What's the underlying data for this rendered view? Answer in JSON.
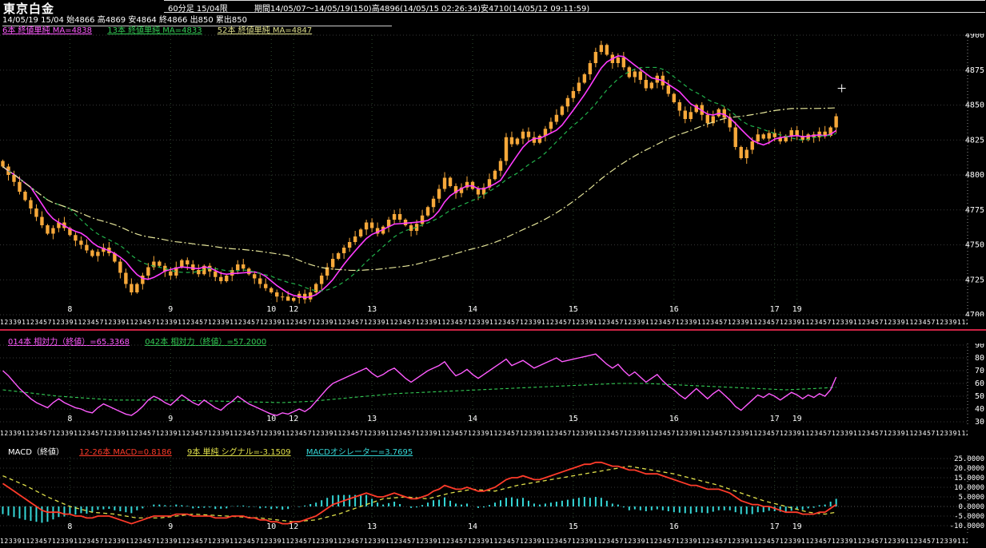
{
  "header": {
    "title": "東京白金",
    "timeframe": "60分足 15/04限",
    "period_info": "期間14/05/07～14/05/19(150)高4896(14/05/15 02:26:34)安4710(14/05/12 09:11:59)",
    "quote_line": "14/05/19 15/04 始4866 高4869 安4864 終4866 出850 累出850",
    "ma_legend": [
      {
        "label": "6本 終値単純 MA=4838",
        "color": "#ff5bff"
      },
      {
        "label": "13本 終値単純 MA=4833",
        "color": "#33cc55"
      },
      {
        "label": "52本 終値単純 MA=4847",
        "color": "#dede8a"
      }
    ]
  },
  "colors": {
    "background": "#000000",
    "candle": "#f6a83a",
    "grid": "#383838",
    "day_grid": "#2d4a2d",
    "axis_text": "#ffffff",
    "separator": "#cc2244",
    "cursor": "#ffffff",
    "right_border": "#999999"
  },
  "time_axis": {
    "pattern": "123391123457",
    "repeat": 20
  },
  "chart_data": [
    {
      "type": "candlestick",
      "title": "東京白金 60分足 15/04限",
      "ylim": [
        4700,
        4900
      ],
      "yticks": [
        4900,
        4875,
        4850,
        4825,
        4800,
        4775,
        4750,
        4725,
        4700
      ],
      "total_slots": 173,
      "first_open": 4810,
      "high": {
        "value": 4896,
        "bar": 107,
        "time": "14/05/15 02:26:34"
      },
      "low": {
        "value": 4710,
        "bar": 51,
        "time": "14/05/12 09:11:59"
      },
      "cursor": {
        "bar": 150,
        "price": 4862
      },
      "closes": [
        4806,
        4800,
        4795,
        4788,
        4782,
        4776,
        4770,
        4764,
        4758,
        4762,
        4766,
        4762,
        4757,
        4753,
        4750,
        4746,
        4742,
        4745,
        4748,
        4744,
        4738,
        4730,
        4722,
        4716,
        4722,
        4728,
        4734,
        4738,
        4735,
        4731,
        4728,
        4734,
        4739,
        4736,
        4732,
        4729,
        4735,
        4731,
        4727,
        4724,
        4728,
        4732,
        4736,
        4733,
        4729,
        4726,
        4722,
        4719,
        4716,
        4713,
        4713,
        4710,
        4712,
        4715,
        4711,
        4716,
        4722,
        4728,
        4734,
        4740,
        4744,
        4748,
        4752,
        4756,
        4761,
        4766,
        4762,
        4758,
        4763,
        4768,
        4772,
        4768,
        4764,
        4760,
        4765,
        4771,
        4777,
        4783,
        4790,
        4798,
        4792,
        4787,
        4791,
        4795,
        4790,
        4786,
        4791,
        4797,
        4803,
        4810,
        4827,
        4822,
        4826,
        4831,
        4827,
        4823,
        4828,
        4833,
        4838,
        4843,
        4849,
        4855,
        4860,
        4866,
        4872,
        4880,
        4888,
        4893,
        4886,
        4880,
        4884,
        4877,
        4870,
        4874,
        4868,
        4862,
        4866,
        4871,
        4864,
        4858,
        4852,
        4846,
        4840,
        4845,
        4850,
        4843,
        4837,
        4842,
        4847,
        4841,
        4834,
        4820,
        4812,
        4818,
        4824,
        4829,
        4826,
        4830,
        4827,
        4824,
        4828,
        4832,
        4828,
        4825,
        4829,
        4827,
        4831,
        4828,
        4834,
        4842
      ],
      "day_labels": [
        {
          "label": "8",
          "bar": 12
        },
        {
          "label": "9",
          "bar": 30
        },
        {
          "label": "10",
          "bar": 48
        },
        {
          "label": "12",
          "bar": 52
        },
        {
          "label": "13",
          "bar": 66
        },
        {
          "label": "14",
          "bar": 84
        },
        {
          "label": "15",
          "bar": 102
        },
        {
          "label": "16",
          "bar": 120
        },
        {
          "label": "17",
          "bar": 138
        },
        {
          "label": "19",
          "bar": 142
        }
      ],
      "moving_averages": [
        {
          "name": "MA6",
          "period": 6,
          "color": "#ff3bff",
          "style": "solid"
        },
        {
          "name": "MA13",
          "period": 13,
          "color": "#21b14b",
          "style": "dashed"
        },
        {
          "name": "MA52",
          "period": 52,
          "color": "#e6e69a",
          "style": "dashdot"
        }
      ]
    },
    {
      "type": "line",
      "name": "RSI",
      "legend": [
        {
          "label": "014本 相対力（終値）=65.3368",
          "color": "#ff5bff"
        },
        {
          "label": "042本 相対力（終値）=57.2000",
          "color": "#33cc55"
        }
      ],
      "ylim": [
        30,
        90
      ],
      "yticks": [
        90,
        80,
        70,
        60,
        50,
        40,
        30
      ],
      "rsi14": [
        70,
        66,
        61,
        56,
        52,
        48,
        45,
        43,
        41,
        45,
        48,
        45,
        43,
        41,
        40,
        38,
        37,
        41,
        44,
        42,
        40,
        38,
        36,
        35,
        38,
        42,
        47,
        50,
        48,
        45,
        43,
        47,
        51,
        48,
        45,
        43,
        47,
        44,
        41,
        39,
        43,
        46,
        50,
        47,
        44,
        42,
        40,
        38,
        36,
        35,
        37,
        36,
        38,
        40,
        38,
        41,
        46,
        51,
        56,
        60,
        62,
        64,
        66,
        68,
        70,
        72,
        68,
        65,
        67,
        70,
        72,
        68,
        64,
        61,
        64,
        67,
        70,
        72,
        74,
        77,
        71,
        66,
        68,
        71,
        67,
        64,
        67,
        70,
        73,
        76,
        79,
        74,
        76,
        78,
        75,
        72,
        74,
        76,
        78,
        80,
        77,
        78,
        79,
        80,
        81,
        82,
        83,
        79,
        75,
        72,
        75,
        70,
        66,
        69,
        65,
        61,
        64,
        67,
        62,
        58,
        55,
        51,
        48,
        52,
        56,
        52,
        48,
        52,
        55,
        51,
        47,
        42,
        39,
        43,
        47,
        51,
        49,
        52,
        50,
        47,
        50,
        53,
        51,
        48,
        51,
        49,
        52,
        50,
        55,
        65
      ],
      "rsi42_points": [
        [
          0,
          55
        ],
        [
          10,
          50
        ],
        [
          20,
          47
        ],
        [
          30,
          47
        ],
        [
          40,
          46
        ],
        [
          50,
          45
        ],
        [
          55,
          46
        ],
        [
          60,
          48
        ],
        [
          65,
          50
        ],
        [
          70,
          52
        ],
        [
          75,
          53
        ],
        [
          80,
          54
        ],
        [
          85,
          55
        ],
        [
          90,
          56
        ],
        [
          95,
          57
        ],
        [
          100,
          58
        ],
        [
          105,
          59
        ],
        [
          110,
          60
        ],
        [
          115,
          60
        ],
        [
          120,
          59
        ],
        [
          125,
          58
        ],
        [
          130,
          57
        ],
        [
          135,
          56
        ],
        [
          140,
          55
        ],
        [
          145,
          56
        ],
        [
          149,
          57
        ]
      ]
    },
    {
      "type": "macd",
      "legend": [
        {
          "label": "MACD（終値）",
          "color": "#ffffff"
        },
        {
          "label": "12-26本 MACD=0.8186",
          "color": "#ff3b2a"
        },
        {
          "label": "9本 単純 シグナル=-3.1509",
          "color": "#e0e04a"
        },
        {
          "label": "MACDオシレーター=3.7695",
          "color": "#35d8d8"
        }
      ],
      "ylim": [
        -10,
        25
      ],
      "yticks": [
        25,
        20,
        15,
        10,
        5,
        0,
        -5,
        -10
      ],
      "ytick_labels": [
        "25.0000",
        "20.0000",
        "15.0000",
        "10.0000",
        "5.0000",
        "0.0000",
        "-5.0000",
        "-10.0000"
      ],
      "macd": [
        12,
        10,
        8,
        6,
        4,
        2,
        0,
        -2,
        -3,
        -3,
        -3,
        -4,
        -4,
        -5,
        -5,
        -6,
        -6,
        -5,
        -5,
        -5,
        -6,
        -7,
        -8,
        -9,
        -8,
        -7,
        -6,
        -5,
        -5,
        -5,
        -5,
        -4,
        -4,
        -4,
        -5,
        -5,
        -5,
        -5,
        -6,
        -6,
        -6,
        -5,
        -5,
        -5,
        -6,
        -6,
        -7,
        -7,
        -8,
        -8,
        -9,
        -9,
        -8,
        -8,
        -7,
        -6,
        -5,
        -3,
        -1,
        1,
        2,
        3,
        4,
        5,
        6,
        7,
        6,
        5,
        5,
        6,
        7,
        6,
        5,
        4,
        4,
        5,
        6,
        8,
        9,
        11,
        10,
        9,
        9,
        10,
        9,
        8,
        8,
        9,
        10,
        12,
        14,
        15,
        15,
        16,
        15,
        14,
        14,
        15,
        16,
        17,
        18,
        19,
        20,
        21,
        22,
        22,
        23,
        23,
        22,
        21,
        21,
        20,
        19,
        19,
        18,
        17,
        17,
        17,
        16,
        15,
        14,
        13,
        12,
        11,
        11,
        10,
        9,
        9,
        9,
        8,
        7,
        5,
        3,
        2,
        1,
        1,
        0,
        0,
        -1,
        -2,
        -3,
        -3,
        -3,
        -4,
        -4,
        -4,
        -3,
        -3,
        -1,
        1
      ],
      "signal_points": [
        [
          0,
          16
        ],
        [
          4,
          11
        ],
        [
          8,
          5
        ],
        [
          12,
          0
        ],
        [
          16,
          -3
        ],
        [
          20,
          -4
        ],
        [
          24,
          -6
        ],
        [
          28,
          -6
        ],
        [
          34,
          -4
        ],
        [
          40,
          -5
        ],
        [
          46,
          -6
        ],
        [
          52,
          -8
        ],
        [
          56,
          -7
        ],
        [
          60,
          -4
        ],
        [
          64,
          0
        ],
        [
          68,
          4
        ],
        [
          72,
          5
        ],
        [
          76,
          4
        ],
        [
          80,
          7
        ],
        [
          84,
          9
        ],
        [
          88,
          8
        ],
        [
          92,
          11
        ],
        [
          96,
          13
        ],
        [
          100,
          15
        ],
        [
          104,
          17
        ],
        [
          108,
          19
        ],
        [
          112,
          21
        ],
        [
          116,
          19
        ],
        [
          120,
          17
        ],
        [
          124,
          14
        ],
        [
          128,
          11
        ],
        [
          132,
          7
        ],
        [
          136,
          3
        ],
        [
          140,
          0
        ],
        [
          144,
          -3
        ],
        [
          147,
          -4
        ],
        [
          149,
          -3
        ]
      ]
    }
  ]
}
